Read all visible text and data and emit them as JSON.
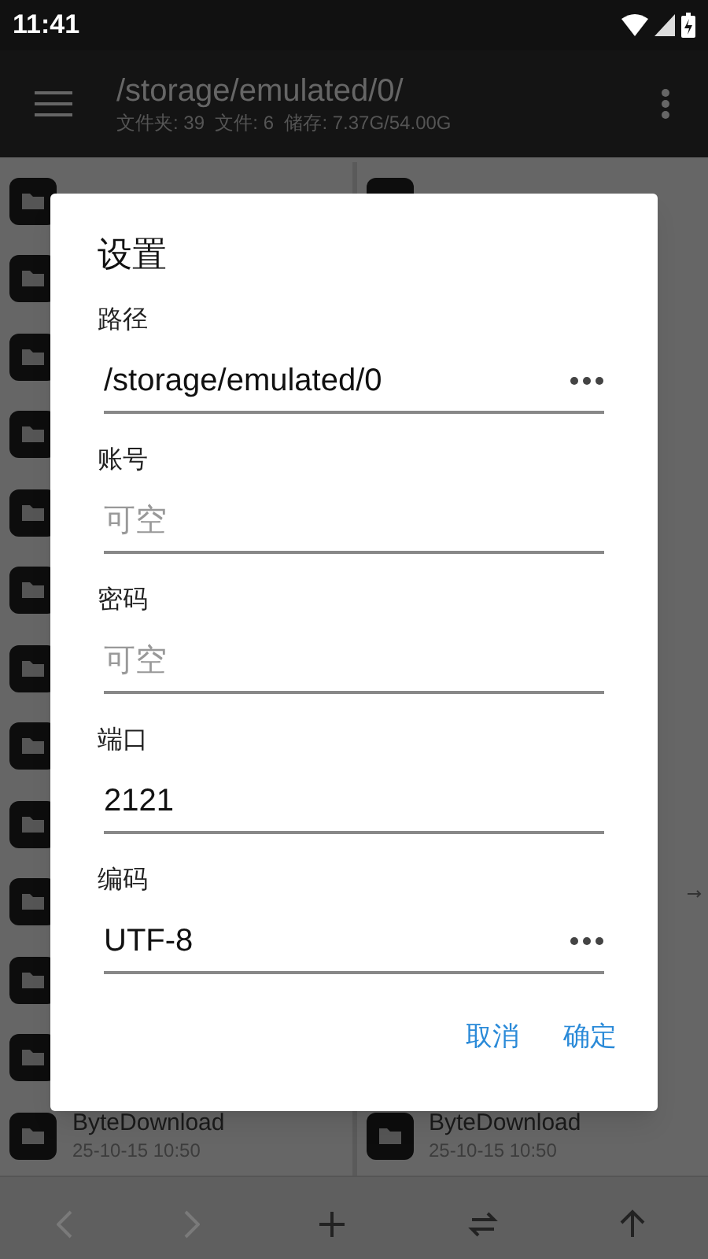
{
  "status_bar": {
    "time": "11:41"
  },
  "app_bar": {
    "title": "/storage/emulated/0/",
    "subtitle": "文件夹: 39  文件: 6  储存: 7.37G/54.00G"
  },
  "panes": [
    {
      "last": {
        "name": "ByteDownload",
        "date": "25-10-15 10:50"
      }
    },
    {
      "last": {
        "name": "ByteDownload",
        "date": "25-10-15 10:50"
      }
    }
  ],
  "dialog": {
    "title": "设置",
    "fields": [
      {
        "label": "路径",
        "value": "/storage/emulated/0",
        "kind": "picker"
      },
      {
        "label": "账号",
        "placeholder": "可空",
        "kind": "text"
      },
      {
        "label": "密码",
        "placeholder": "可空",
        "kind": "text"
      },
      {
        "label": "端口",
        "value": "2121",
        "kind": "text"
      },
      {
        "label": "编码",
        "value": "UTF-8",
        "kind": "picker"
      }
    ],
    "buttons": [
      "取消",
      "确定"
    ]
  },
  "toolbar": [
    {
      "kind": "back",
      "disabled": true
    },
    {
      "kind": "forward",
      "disabled": true
    },
    {
      "kind": "add",
      "disabled": false
    },
    {
      "kind": "swap",
      "disabled": false
    },
    {
      "kind": "up",
      "disabled": false
    }
  ]
}
